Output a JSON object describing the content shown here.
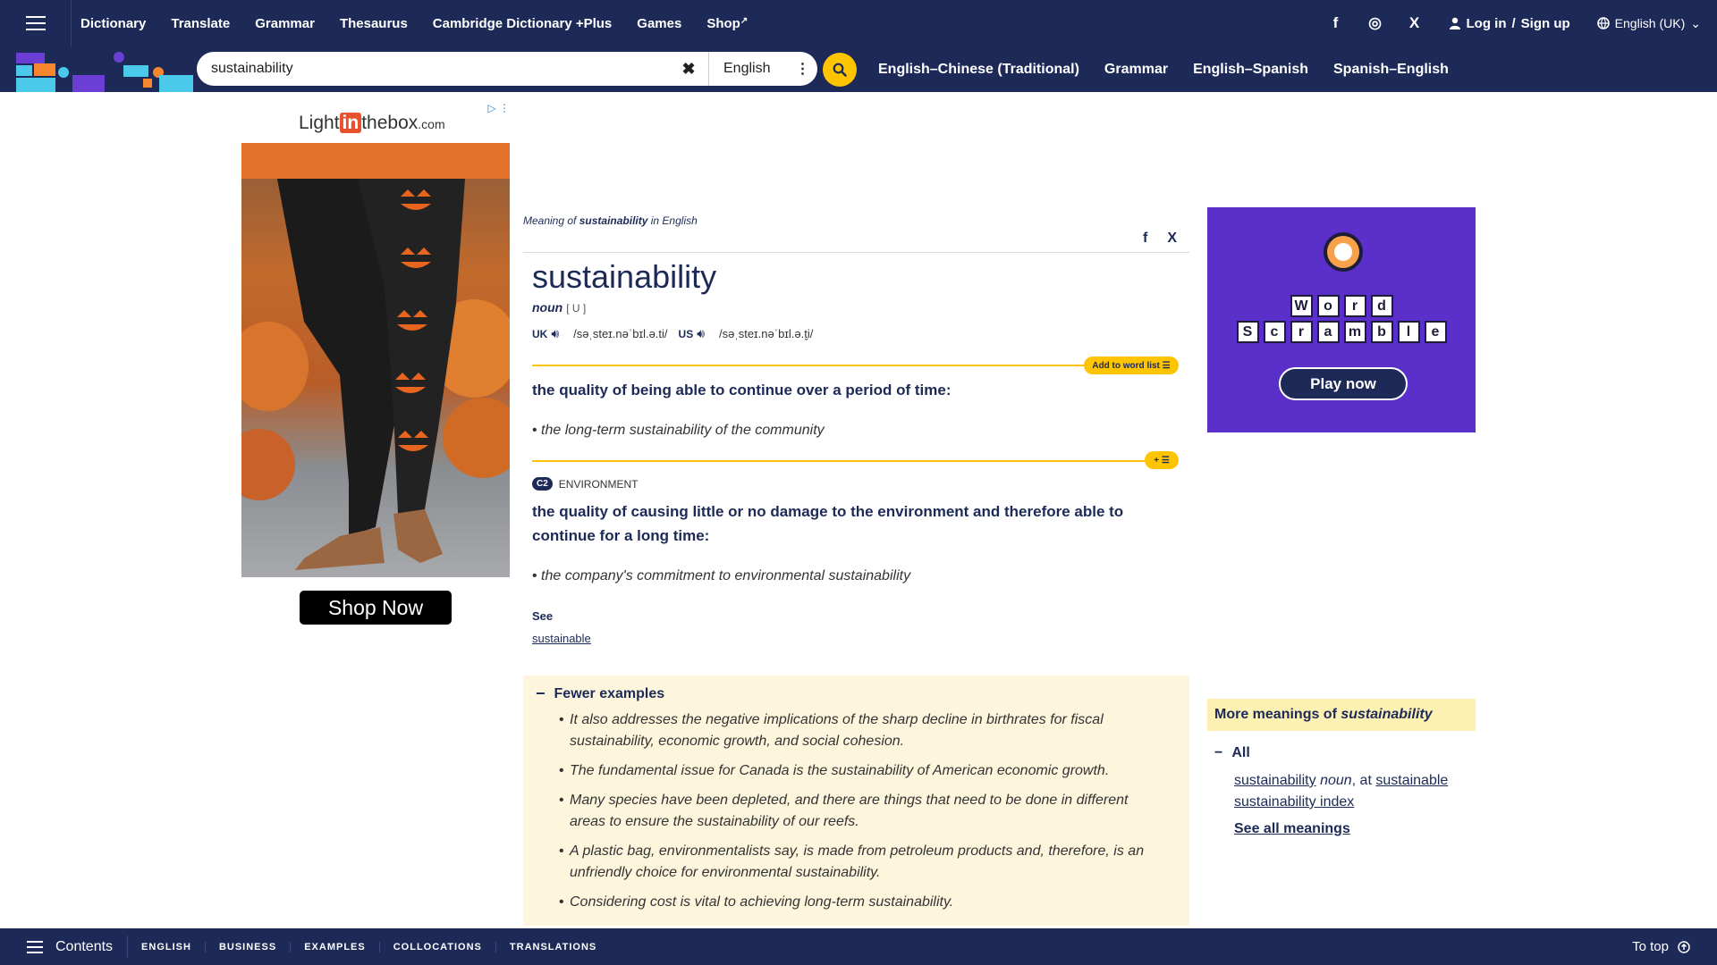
{
  "header": {
    "nav": [
      "Dictionary",
      "Translate",
      "Grammar",
      "Thesaurus",
      "Cambridge Dictionary +Plus",
      "Games",
      "Shop"
    ],
    "social": [
      "f",
      "◎",
      "X"
    ],
    "login": "Log in",
    "signup_sep": "/",
    "signup": "Sign up",
    "language": "English (UK)"
  },
  "search": {
    "value": "sustainability",
    "dictionary": "English",
    "links": [
      "English–Chinese (Traditional)",
      "Grammar",
      "English–Spanish",
      "Spanish–English"
    ]
  },
  "ad_left": {
    "brand_pre": "Light",
    "brand_in": "in",
    "brand_post": "thebox",
    "brand_com": ".com",
    "cta": "Shop Now"
  },
  "entry": {
    "meaning_prefix": "Meaning of",
    "meaning_word": "sustainability",
    "meaning_suffix": "in English",
    "headword": "sustainability",
    "pos": "noun",
    "grammar": "[ U ]",
    "uk_label": "UK",
    "uk_ipa": "/səˌsteɪ.nəˈbɪl.ə.ti/",
    "us_label": "US",
    "us_ipa": "/səˌsteɪ.nəˈbɪl.ə.t̬i/",
    "add_to_word_list": "Add to word list",
    "sense1": {
      "definition": "the quality of being able to continue over a period of time:",
      "example": "the long-term sustainability of the community"
    },
    "sense2": {
      "level": "C2",
      "domain": "ENVIRONMENT",
      "definition": "the quality of causing little or no damage to the environment and therefore able to continue for a long time:",
      "example": "the company's commitment to environmental sustainability",
      "see_label": "See",
      "see_link": "sustainable"
    }
  },
  "more_examples": {
    "toggle": "Fewer examples",
    "items": [
      "It also addresses the negative implications of the sharp decline in birthrates for fiscal sustainability, economic growth, and social cohesion.",
      "The fundamental issue for Canada is the sustainability of American economic growth.",
      "Many species have been depleted, and there are things that need to be done in different areas to ensure the sustainability of our reefs.",
      "A plastic bag, environmentalists say, is made from petroleum products and, therefore, is an unfriendly choice for environmental sustainability.",
      "Considering cost is vital to achieving long-term sustainability."
    ]
  },
  "ad_right": {
    "word1": [
      "W",
      "o",
      "r",
      "d"
    ],
    "word2": [
      "S",
      "c",
      "r",
      "a",
      "m",
      "b",
      "l",
      "e"
    ],
    "cta": "Play now"
  },
  "more_meanings": {
    "title_prefix": "More meanings of",
    "title_word": "sustainability",
    "all": "All",
    "link1": "sustainability",
    "link1_pos": "noun",
    "link1_mid": ", at",
    "link1_target": "sustainable",
    "link2": "sustainability index",
    "see_all": "See all meanings"
  },
  "footer": {
    "contents": "Contents",
    "tabs": [
      "ENGLISH",
      "BUSINESS",
      "EXAMPLES",
      "COLLOCATIONS",
      "TRANSLATIONS"
    ],
    "to_top": "To top"
  }
}
